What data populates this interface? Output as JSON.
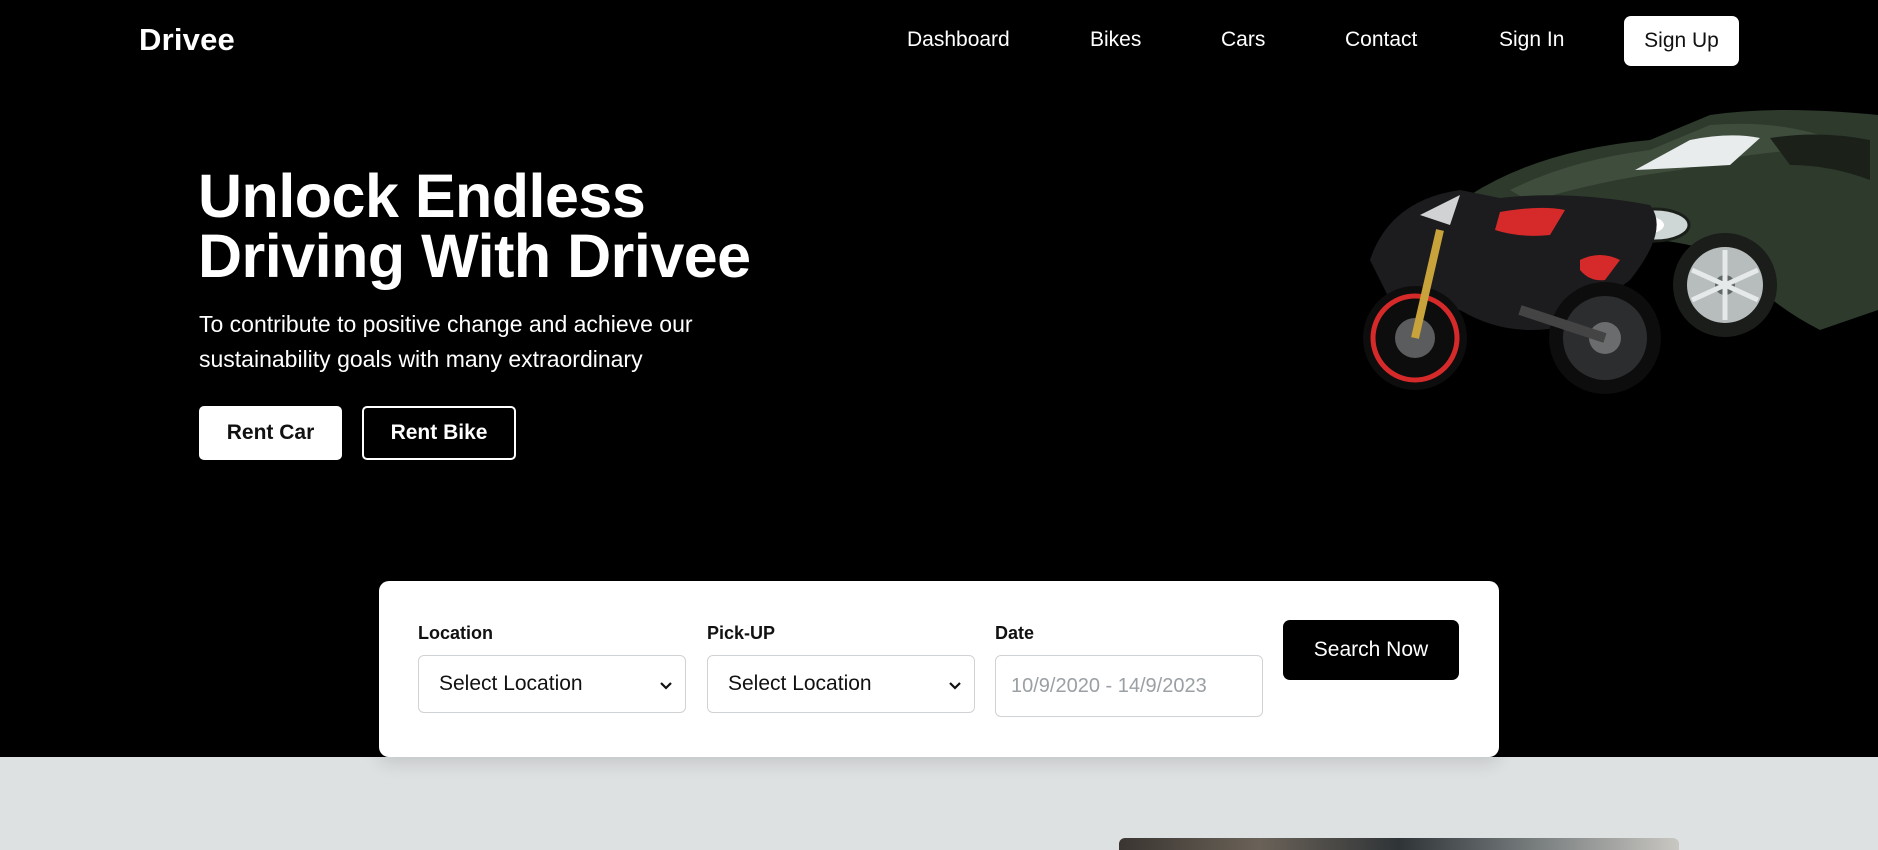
{
  "brand": {
    "name": "Drivee"
  },
  "nav": {
    "links": [
      {
        "label": "Dashboard"
      },
      {
        "label": "Bikes"
      },
      {
        "label": "Cars"
      },
      {
        "label": "Contact"
      },
      {
        "label": "Sign In"
      }
    ],
    "signup_label": "Sign Up"
  },
  "hero": {
    "title_line1": "Unlock Endless",
    "title_line2": "Driving With Drivee",
    "subtitle": "To contribute to positive change and achieve our sustainability goals with many extraordinary",
    "rent_car_label": "Rent Car",
    "rent_bike_label": "Rent Bike",
    "illustration_icon": "car-and-motorcycle-illustration"
  },
  "search": {
    "location_label": "Location",
    "location_value": "Select Location",
    "pickup_label": "Pick-UP",
    "pickup_value": "Select Location",
    "date_label": "Date",
    "date_placeholder": "10/9/2020 - 14/9/2023",
    "search_label": "Search Now"
  },
  "colors": {
    "background": "#000000",
    "card": "#ffffff",
    "lower_band": "#dee1e2",
    "accent_red": "#d62a2a",
    "car_green": "#2d3a2c"
  }
}
